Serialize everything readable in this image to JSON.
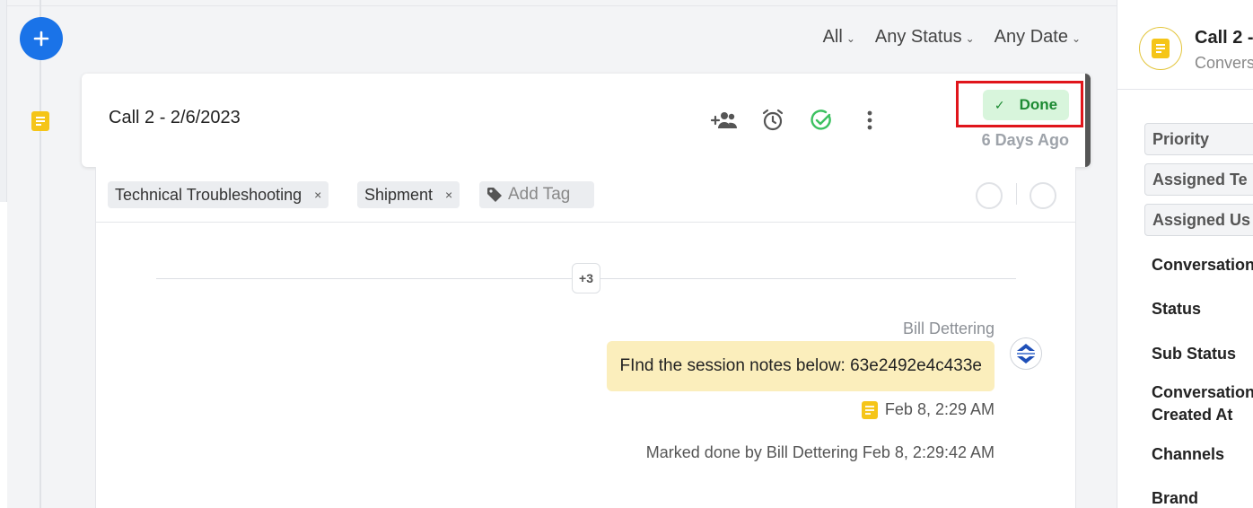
{
  "filters": {
    "type": "All",
    "status": "Any Status",
    "date": "Any Date"
  },
  "card": {
    "title": "Call 2 - 2/6/2023",
    "status_label": "Done",
    "age": "6 Days Ago"
  },
  "tags": {
    "items": [
      "Technical Troubleshooting",
      "Shipment"
    ],
    "add_placeholder": "Add Tag"
  },
  "thread": {
    "more_count": "+3",
    "sender": "Bill Dettering",
    "message": "FInd the session notes below: 63e2492e4c433e",
    "timestamp": "Feb 8, 2:29 AM",
    "event": "Marked done by Bill Dettering Feb 8, 2:29:42 AM"
  },
  "right_panel": {
    "title": "Call 2 -",
    "subtitle": "Convers",
    "buttons": [
      "Priority",
      "Assigned Te",
      "Assigned Us"
    ],
    "fields": [
      "Conversation",
      "Status",
      "Sub Status",
      "Conversation Created At",
      "Channels",
      "Brand"
    ]
  },
  "colors": {
    "primary": "#1a73e8",
    "done_bg": "#d8f5dc",
    "done_text": "#1c8a32",
    "highlight": "#e0151b",
    "note_bubble": "#fbeebc",
    "note_icon": "#f5c518"
  }
}
